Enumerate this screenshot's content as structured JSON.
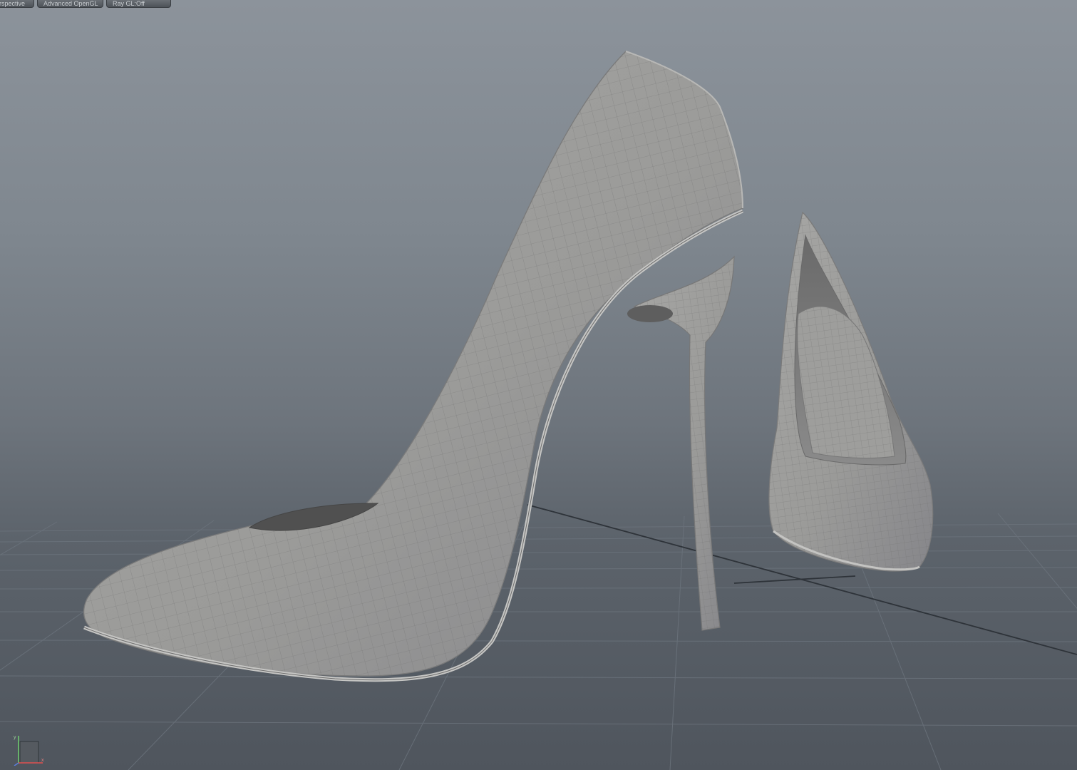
{
  "viewport": {
    "camera_menu_label": "rspective",
    "renderer_menu_label": "Advanced OpenGL",
    "ray_menu_label": "Ray GL:Off"
  },
  "axis_gizmo": {
    "up_axis_label": "y",
    "right_axis_label": "x"
  },
  "scene": {
    "objects": [
      "high-heel-pump-left",
      "high-heel-pump-right"
    ],
    "background_top_color": "#8c939b",
    "background_bottom_color": "#4f555d",
    "grid_color": "#6b737c",
    "model_color": "#9a9a98",
    "axis_y_color": "#6fd06f",
    "axis_x_color": "#e05050"
  }
}
